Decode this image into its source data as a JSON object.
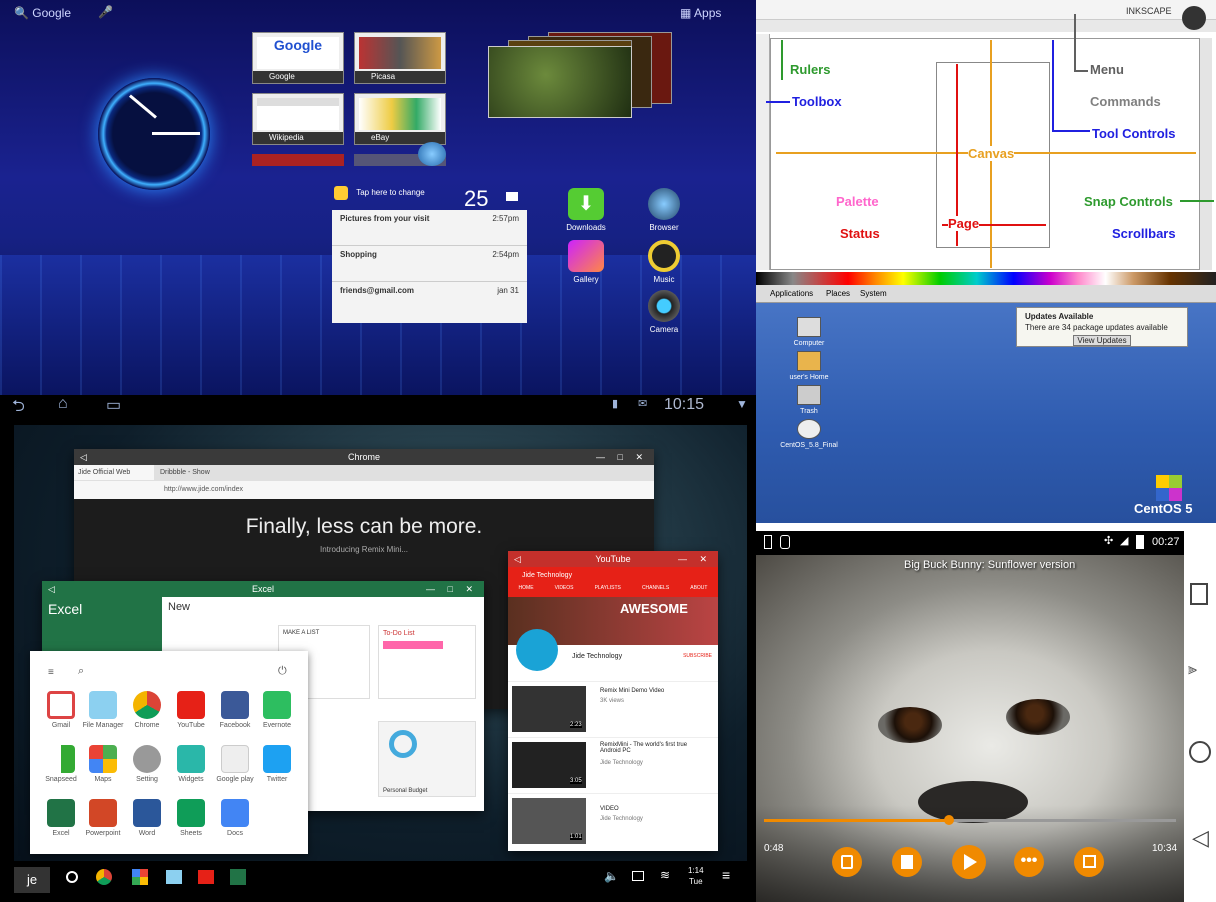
{
  "honeycomb": {
    "search_label": "Google",
    "apps_label": "Apps",
    "thumbs": [
      "Google",
      "Picasa",
      "Wikipedia",
      "eBay"
    ],
    "notif_header": "Tap here to change",
    "notif_temp": "25",
    "notifs": [
      {
        "title": "Pictures from your visit",
        "time": "2:57pm"
      },
      {
        "title": "Shopping",
        "time": "2:54pm"
      },
      {
        "title": "friends@gmail.com",
        "time": "jan 31"
      }
    ],
    "apps": [
      "Downloads",
      "Browser",
      "Gallery",
      "Music",
      "Camera"
    ],
    "time": "10:15"
  },
  "inkscape": {
    "brand": "INKSCAPE",
    "labels": {
      "rulers": "Rulers",
      "toolbox": "Toolbox",
      "menu": "Menu",
      "commands": "Commands",
      "tool_controls": "Tool Controls",
      "canvas": "Canvas",
      "palette": "Palette",
      "status": "Status",
      "page": "Page",
      "snap_controls": "Snap Controls",
      "scrollbars": "Scrollbars"
    },
    "colors": {
      "green": "#2e9a2e",
      "blue": "#2020e0",
      "gray": "#606060",
      "orange": "#e8a020",
      "pink": "#ff66cc",
      "red": "#e01010"
    }
  },
  "centos": {
    "panel": [
      "Applications",
      "Places",
      "System"
    ],
    "update_title": "Updates Available",
    "update_text": "There are 34 package updates available",
    "update_button": "View Updates",
    "desktop": [
      "Computer",
      "user's Home",
      "Trash",
      "CentOS_5.8_Final"
    ],
    "logo": "CentOS 5"
  },
  "remix": {
    "chrome_title": "Chrome",
    "chrome_tabs": [
      "Jide Official Web",
      "Dribbble - Show"
    ],
    "chrome_url": "http://www.jide.com/index",
    "hero": "Finally, less can be more.",
    "hero_sub": "Introducing Remix Mini...",
    "excel_title": "Excel",
    "excel_brand": "Excel",
    "excel_new": "New",
    "excel_make": "MAKE A LIST",
    "excel_todo": "To-Do List",
    "excel_budget": "Personal Budget",
    "youtube_title": "YouTube",
    "yt_channel": "Jide Technology",
    "yt_tabs": [
      "HOME",
      "VIDEOS",
      "PLAYLISTS",
      "CHANNELS",
      "ABOUT"
    ],
    "yt_banner": "AWESOME",
    "yt_subscribe": "SUBSCRIBE",
    "yt_videos": [
      {
        "title": "Remix Mini Demo Video",
        "meta": "3K views",
        "dur": "2:23"
      },
      {
        "title": "RemixMini - The world's first true Android PC",
        "meta": "Jide Technology",
        "dur": "3:05"
      },
      {
        "title": "VIDEO",
        "meta": "Jide Technology",
        "dur": "1:01"
      }
    ],
    "launcher_apps": [
      "Gmail",
      "File Manager",
      "Chrome",
      "YouTube",
      "Facebook",
      "Evernote",
      "Snapseed",
      "Maps",
      "Setting",
      "Widgets",
      "Google play",
      "Twitter",
      "Excel",
      "Powerpoint",
      "Word",
      "Sheets",
      "Docs"
    ],
    "clock_time": "1:14",
    "clock_day": "Tue"
  },
  "vlc": {
    "status_time": "00:27",
    "title": "Big Buck Bunny: Sunflower version",
    "elapsed": "0:48",
    "total": "10:34",
    "progress": 0.45,
    "accent": "#f08a00"
  }
}
